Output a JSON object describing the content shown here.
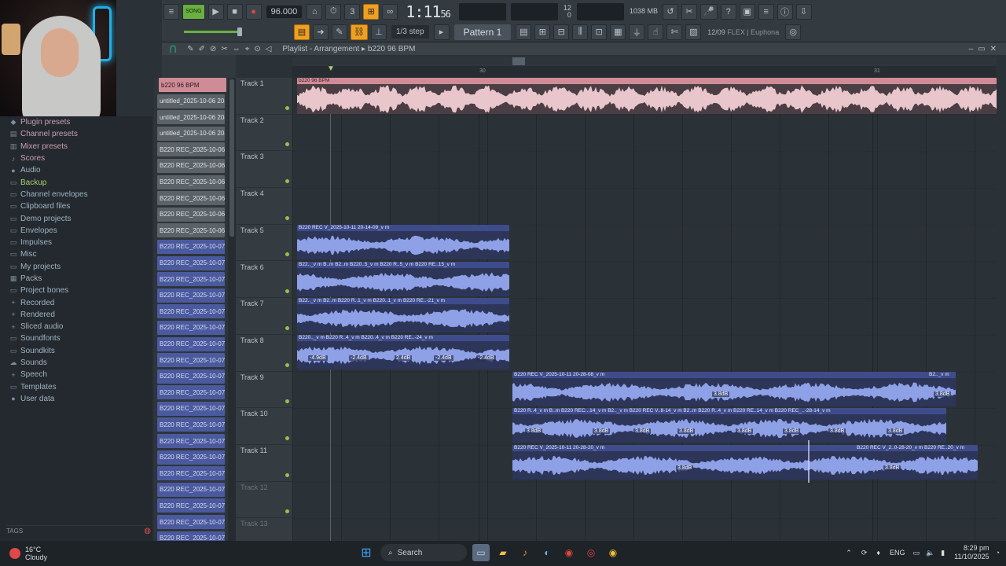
{
  "toolbar": {
    "song_label": "SONG",
    "tempo": "96.000",
    "time_main": "1:11",
    "time_sub": "56",
    "time_unit": "M:S:CS",
    "cpu_value": "12",
    "mem_value": "1038 MB",
    "mem_sub": "0",
    "snap": "1/3 step",
    "pattern": "Pattern 1",
    "hint_prefix": "12/09",
    "hint_text": "FLEX | Euphona"
  },
  "playlist": {
    "breadcrumb_a": "Playlist - Arrangement",
    "breadcrumb_b": "b220 96 BPM",
    "ruler_marks": [
      "30",
      "31"
    ]
  },
  "browser": {
    "items": [
      {
        "label": "Plugin presets",
        "icon": "plugin-icon",
        "style": "hl"
      },
      {
        "label": "Channel presets",
        "icon": "channel-icon",
        "style": "hl"
      },
      {
        "label": "Mixer presets",
        "icon": "mixer-icon",
        "style": "hl"
      },
      {
        "label": "Scores",
        "icon": "score-icon",
        "style": "hl"
      },
      {
        "label": "Audio",
        "icon": "person-icon",
        "style": ""
      },
      {
        "label": "Backup",
        "icon": "folder-icon",
        "style": "green"
      },
      {
        "label": "Channel envelopes",
        "icon": "folder-icon",
        "style": ""
      },
      {
        "label": "Clipboard files",
        "icon": "folder-icon",
        "style": ""
      },
      {
        "label": "Demo projects",
        "icon": "folder-icon",
        "style": ""
      },
      {
        "label": "Envelopes",
        "icon": "folder-icon",
        "style": ""
      },
      {
        "label": "Impulses",
        "icon": "folder-icon",
        "style": ""
      },
      {
        "label": "Misc",
        "icon": "folder-icon",
        "style": ""
      },
      {
        "label": "My projects",
        "icon": "folder-icon",
        "style": ""
      },
      {
        "label": "Packs",
        "icon": "pack-icon",
        "style": ""
      },
      {
        "label": "Project bones",
        "icon": "folder-icon",
        "style": ""
      },
      {
        "label": "Recorded",
        "icon": "plus-icon",
        "style": ""
      },
      {
        "label": "Rendered",
        "icon": "plus-icon",
        "style": ""
      },
      {
        "label": "Sliced audio",
        "icon": "plus-icon",
        "style": ""
      },
      {
        "label": "Soundfonts",
        "icon": "folder-icon",
        "style": ""
      },
      {
        "label": "Soundkits",
        "icon": "folder-icon",
        "style": ""
      },
      {
        "label": "Sounds",
        "icon": "cloud-icon",
        "style": ""
      },
      {
        "label": "Speech",
        "icon": "plus-icon",
        "style": ""
      },
      {
        "label": "Templates",
        "icon": "folder-icon",
        "style": ""
      },
      {
        "label": "User data",
        "icon": "person-icon",
        "style": ""
      }
    ],
    "tags_label": "TAGS"
  },
  "clips": [
    {
      "label": "b220 96 BPM",
      "style": "sel"
    },
    {
      "label": "untitled_2025-10-06 20-",
      "style": "grey"
    },
    {
      "label": "untitled_2025-10-06 20-",
      "style": "grey"
    },
    {
      "label": "untitled_2025-10-06 20-",
      "style": "grey"
    },
    {
      "label": "B220 REC_2025-10-06 20",
      "style": "grey"
    },
    {
      "label": "B220 REC_2025-10-06 20",
      "style": "grey"
    },
    {
      "label": "B220 REC_2025-10-06 20",
      "style": "grey"
    },
    {
      "label": "B220 REC_2025-10-06 20",
      "style": "grey"
    },
    {
      "label": "B220 REC_2025-10-06 20",
      "style": "grey"
    },
    {
      "label": "B220 REC_2025-10-06 20",
      "style": "grey"
    },
    {
      "label": "B220 REC_2025-10-07 20",
      "style": ""
    },
    {
      "label": "B220 REC_2025-10-07 20",
      "style": ""
    },
    {
      "label": "B220 REC_2025-10-07 20",
      "style": ""
    },
    {
      "label": "B220 REC_2025-10-07 20",
      "style": ""
    },
    {
      "label": "B220 REC_2025-10-07 20",
      "style": ""
    },
    {
      "label": "B220 REC_2025-10-07 20",
      "style": ""
    },
    {
      "label": "B220 REC_2025-10-07 21",
      "style": ""
    },
    {
      "label": "B220 REC_2025-10-07 21",
      "style": ""
    },
    {
      "label": "B220 REC_2025-10-07 21",
      "style": ""
    },
    {
      "label": "B220 REC_2025-10-07 21",
      "style": ""
    },
    {
      "label": "B220 REC_2025-10-07 21",
      "style": ""
    },
    {
      "label": "B220 REC_2025-10-07 21",
      "style": ""
    },
    {
      "label": "B220 REC_2025-10-07 21",
      "style": ""
    },
    {
      "label": "B220 REC_2025-10-07 21",
      "style": ""
    },
    {
      "label": "B220 REC_2025-10-07 21",
      "style": ""
    },
    {
      "label": "B220 REC_2025-10-07 21",
      "style": ""
    },
    {
      "label": "B220 REC_2025-10-07 21",
      "style": ""
    },
    {
      "label": "B220 REC_2025-10-07 21",
      "style": ""
    },
    {
      "label": "B220 REC_2025-10-07 21",
      "style": ""
    }
  ],
  "tracks": [
    "Track 1",
    "Track 2",
    "Track 3",
    "Track 4",
    "Track 5",
    "Track 6",
    "Track 7",
    "Track 8",
    "Track 9",
    "Track 10",
    "Track 11",
    "Track 12",
    "Track 13"
  ],
  "arrangement": {
    "t1": "b220 96 BPM",
    "t5": "B220 REC V_2025-10-11 20-14-09_v m",
    "t6": "B22.._v m  B..m  B2..m  B220..5_v m  B220 R..5_v m  B220 RE..15_v m",
    "t7": "B22.._v m  B2..m  B220 R..1_v m  B220..1_v m  B220 RE..-21_v m",
    "t8": "B220.._v m  B220 R..4_v m  B220..4_v m  B220 RE..-24_v m",
    "t9": "B220 REC V_2025-10-11 20-28-08_v m",
    "t9b": "B2.._v m",
    "t10": "B220 R..4_v m  B..m  B220 REC...14_v m  B2.._v m  B220 REC V..8-14_v m  B2..m  B220 R..4_v m  B220 RE..14_v m  B220 REC_..-28-14_v m",
    "t11": "B220 REC V_2025-10-11 20-28-20_v m",
    "t11b": "B220 REC V_2..0-28-20_v m  B220 RE..20_v m",
    "db_labels": [
      "-4.9dB",
      "-2.4dB",
      "2.4dB",
      "-2.4dB",
      "-2.4dB",
      "3.8dB",
      "3.8dB",
      "3.8dB",
      "3.8dB",
      "3.8dB",
      "3.8dB",
      "3.8dB",
      "3.8dB",
      "3.8dB",
      "3.8dB",
      "3.8dB",
      "3.8dB"
    ]
  },
  "taskbar": {
    "temp": "16°C",
    "weather": "Cloudy",
    "search": "Search",
    "lang": "ENG",
    "time": "8:29 pm",
    "date": "11/10/2025"
  }
}
